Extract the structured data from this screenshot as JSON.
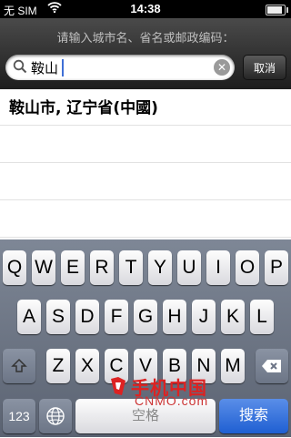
{
  "status_bar": {
    "carrier": "无 SIM",
    "time": "14:38",
    "battery_level": 0.9
  },
  "search": {
    "prompt": "请输入城市名、省名或邮政编码：",
    "value": "鞍山",
    "cancel_label": "取消"
  },
  "results": [
    {
      "label": "鞍山市, 辽宁省(中國)"
    },
    {
      "label": ""
    },
    {
      "label": ""
    },
    {
      "label": ""
    }
  ],
  "keyboard": {
    "row1": [
      "Q",
      "W",
      "E",
      "R",
      "T",
      "Y",
      "U",
      "I",
      "O",
      "P"
    ],
    "row2": [
      "A",
      "S",
      "D",
      "F",
      "G",
      "H",
      "J",
      "K",
      "L"
    ],
    "row3": [
      "Z",
      "X",
      "C",
      "V",
      "B",
      "N",
      "M"
    ],
    "numbers_label": "123",
    "space_label": "空格",
    "search_label": "搜索"
  },
  "watermark": {
    "brand": "手机中国",
    "url": "CNMO.com"
  },
  "icons": {
    "search": "magnifier-icon",
    "clear": "clear-icon",
    "shift": "shift-arrow-icon",
    "backspace": "backspace-icon",
    "globe": "globe-icon",
    "wifi": "wifi-icon",
    "battery": "battery-icon"
  }
}
